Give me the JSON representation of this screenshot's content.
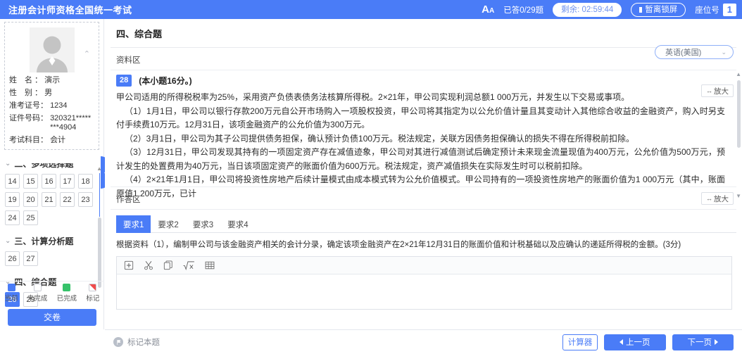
{
  "header": {
    "title": "注册会计师资格全国统一考试",
    "font_icon": "font-size-icon",
    "answered": "已答0/29题",
    "remaining": "剩余: 02:59:44",
    "lock": "暂离锁屏",
    "seat_label": "座位号",
    "seat_number": "1",
    "bg_color": "#4a7cf7"
  },
  "sidebar": {
    "avatar_icon": "user-avatar-icon",
    "collapse_icon": "chevron-up-icon",
    "profile": [
      {
        "label": "姓　名 ：",
        "value": "演示"
      },
      {
        "label": "性　别 ：",
        "value": "男"
      },
      {
        "label": "准考证号：",
        "value": "1234"
      },
      {
        "label": "证件号码：",
        "value": "320321********4904"
      },
      {
        "label": "考试科目：",
        "value": "会计"
      }
    ],
    "groups": [
      {
        "title": "二、多项选择题",
        "questions": [
          {
            "n": "14",
            "state": "normal"
          },
          {
            "n": "15",
            "state": "normal"
          },
          {
            "n": "16",
            "state": "normal"
          },
          {
            "n": "17",
            "state": "normal"
          },
          {
            "n": "18",
            "state": "normal"
          },
          {
            "n": "19",
            "state": "normal"
          },
          {
            "n": "20",
            "state": "normal"
          },
          {
            "n": "21",
            "state": "normal"
          },
          {
            "n": "22",
            "state": "normal"
          },
          {
            "n": "23",
            "state": "normal"
          },
          {
            "n": "24",
            "state": "normal"
          },
          {
            "n": "25",
            "state": "normal"
          }
        ]
      },
      {
        "title": "三、计算分析题",
        "questions": [
          {
            "n": "26",
            "state": "normal"
          },
          {
            "n": "27",
            "state": "normal"
          }
        ]
      },
      {
        "title": "四、综合题",
        "questions": [
          {
            "n": "28",
            "state": "current"
          },
          {
            "n": "29",
            "state": "normal"
          }
        ]
      }
    ],
    "legend": [
      {
        "label": "当前",
        "swatch": "cur"
      },
      {
        "label": "未完成",
        "swatch": "undone"
      },
      {
        "label": "已完成",
        "swatch": "done"
      },
      {
        "label": "标记",
        "swatch": "mark"
      }
    ],
    "submit_label": "交卷"
  },
  "main": {
    "section_title": "四、综合题",
    "language_select": {
      "value": "英语(美国)",
      "caret": "chevron-down-icon"
    },
    "material_label": "资料区",
    "zoom_label": "放大",
    "zoom_icon": "expand-horizontal-icon",
    "question": {
      "number": "28",
      "score": "(本小题16分。)",
      "paragraphs": [
        "甲公司适用的所得税税率为25%，采用资产负债表债务法核算所得税。2×21年，甲公司实现利润总额1 000万元，并发生以下交易或事项。",
        "（1）1月1日，甲公司以银行存款200万元自公开市场购入一项股权投资，甲公司将其指定为以公允价值计量且其变动计入其他综合收益的金融资产，购入时另支付手续费10万元。12月31日，该项金融资产的公允价值为300万元。",
        "（2）3月1日，甲公司为其子公司提供债务担保，确认预计负债100万元。税法规定，关联方因债务担保确认的损失不得在所得税前扣除。",
        "（3）12月31日，甲公司发现其持有的一项固定资产存在减值迹象，甲公司对其进行减值测试后确定预计未来现金流量现值为400万元，公允价值为500万元，预计发生的处置费用为40万元，当日该项固定资产的账面价值为600万元。税法规定，资产减值损失在实际发生时可以税前扣除。",
        "（4）2×21年1月1日，甲公司将投资性房地产后续计量模式由成本模式转为公允价值模式。甲公司持有的一项投资性房地产的账面价值为1 000万元（其中，账面原值1 200万元，已计"
      ]
    },
    "answer_label": "作答区",
    "answer_zoom_label": "放大",
    "tabs": [
      {
        "label": "要求1",
        "active": true
      },
      {
        "label": "要求2",
        "active": false
      },
      {
        "label": "要求3",
        "active": false
      },
      {
        "label": "要求4",
        "active": false
      }
    ],
    "requirement_text": "根据资料（1），编制甲公司与该金融资产相关的会计分录，确定该项金融资产在2×21年12月31日的账面价值和计税基础以及应确认的递延所得税的金额。(3分)",
    "editor_tools": [
      {
        "name": "insert-box-icon"
      },
      {
        "name": "scissors-cut-icon"
      },
      {
        "name": "copy-icon"
      },
      {
        "name": "formula-sqrt-icon"
      },
      {
        "name": "table-icon"
      }
    ],
    "editor_content": ""
  },
  "footer": {
    "mark_label": "标记本题",
    "mark_icon": "flag-icon",
    "calculator_label": "计算器",
    "prev_label": "上一页",
    "next_label": "下一页"
  }
}
